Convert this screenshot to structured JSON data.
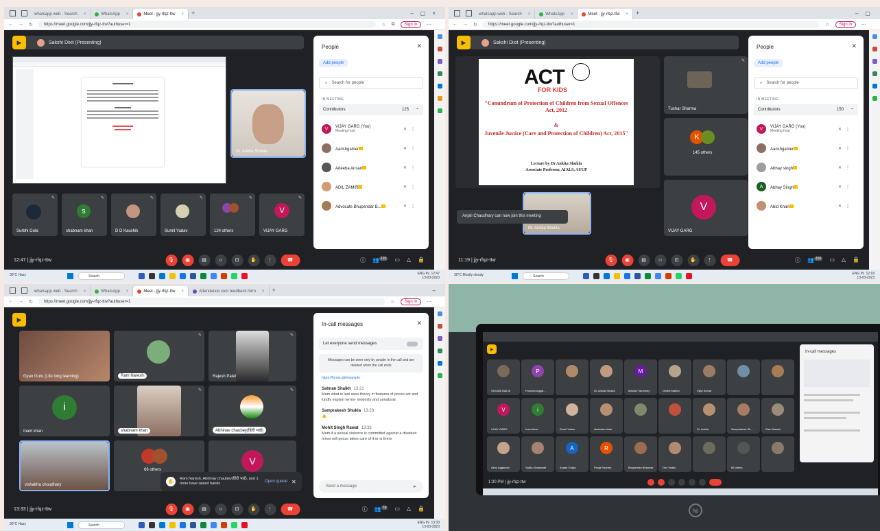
{
  "q1": {
    "tabs": [
      "whatsapp web - Search",
      "WhatsApp",
      "Meet - jjy-rfqz-ttw"
    ],
    "url": "https://meet.google.com/jjy-rfqz-ttw?authuser=1",
    "signin": "Sign in",
    "presenting": "Sakshi Dixit (Presenting)",
    "main_tile_name": "Dr. Ankita Shukla",
    "tiles": [
      "Surbhi Gola",
      "shabnam khan",
      "D D Kaushik",
      "Sumit Yadav",
      "124 others",
      "VIJAY GARG"
    ],
    "tile_initials": [
      "",
      "s",
      "",
      "",
      "",
      "V"
    ],
    "time": "12:47 | jjy-rfqz-ttw",
    "badge": "126",
    "panel": {
      "title": "People",
      "add": "Add people",
      "search": "Search for people",
      "in_meeting": "IN MEETING",
      "contributors": "Contributors",
      "count": "125",
      "people": [
        {
          "name": "VIJAY GARG (You)",
          "sub": "Meeting host",
          "init": "V"
        },
        {
          "name": "Aarishgamer",
          "sub": "",
          "init": ""
        },
        {
          "name": "Adeeba Ansari",
          "sub": "",
          "init": ""
        },
        {
          "name": "ADIL ZAMIR",
          "sub": "",
          "init": ""
        },
        {
          "name": "Advocate Bhupendar B...",
          "sub": "",
          "init": ""
        }
      ]
    },
    "taskbar": {
      "weather": "30°C Hazy",
      "search": "Search",
      "time": "12:47",
      "date": "13-03-2023",
      "lang": "ENG IN"
    }
  },
  "q2": {
    "tabs": [
      "whatsapp web - Search",
      "WhatsApp",
      "Meet - jjy-rfqz-ttw"
    ],
    "url": "https://meet.google.com/jjy-rfqz-ttw?authuser=1",
    "signin": "Sign in",
    "presenting": "Sakshi Dixit (Presenting)",
    "slide": {
      "logo1": "ACT",
      "logo2": "FOR KIDS",
      "line1": "\"Conundrum of Protection of Children from Sexual Offences Act, 2012",
      "line2": "&",
      "line3": "Juvenile Justice (Care and Protection of Children) Act, 2015\"",
      "lecture": "Lecture by Dr Ankita Shukla",
      "role": "Associate Professor, AIALS, AUUP"
    },
    "tiles": [
      "Tushar Sharma",
      "145 others",
      "VIJAY GARG"
    ],
    "tile_initials": [
      "",
      "K",
      "V"
    ],
    "self_name": "Dr. Ankita Shukla",
    "toast": "Anjali Chaudhary can now join this meeting",
    "time": "11:19 | jjy-rfqz-ttw",
    "badge": "150",
    "panel": {
      "title": "People",
      "add": "Add people",
      "search": "Search for people",
      "in_meeting": "IN MEETING",
      "contributors": "Contributors",
      "count": "150",
      "people": [
        {
          "name": "VIJAY GARG (You)",
          "sub": "Meeting host",
          "init": "V"
        },
        {
          "name": "Aarishgamer",
          "sub": "",
          "init": ""
        },
        {
          "name": "Abhay singh",
          "sub": "",
          "init": ""
        },
        {
          "name": "Abhay Singh",
          "sub": "",
          "init": "A"
        },
        {
          "name": "Abid Khan",
          "sub": "",
          "init": ""
        }
      ]
    },
    "taskbar": {
      "weather": "30°C Mostly cloudy",
      "search": "Search",
      "time": "12:18",
      "date": "13-03-2023",
      "lang": "ENG IN"
    }
  },
  "q3": {
    "tabs": [
      "whatsapp web - Search",
      "WhatsApp",
      "Meet - jjy-rfqz-ttw",
      "Attendance cum feedback form"
    ],
    "url": "https://meet.google.com/jjy-rfqz-ttw?authuser=1",
    "signin": "Sign in",
    "tiles": [
      "Gyan Guru (Life long learning)",
      "Ram Naresh",
      "Rajesh Patel",
      "Inam khan",
      "shabnam khan",
      "Abhinav chaubey(हिंदी भाई)",
      "vishakha choudhary",
      "66 others",
      ""
    ],
    "tile_initials": [
      "",
      "",
      "",
      "i",
      "",
      "",
      "",
      "",
      "V"
    ],
    "raise": "Ram Naresh, Abhinav chaubey(हिंदी भाई), and 1 more have raised hands",
    "open_queue": "Open queue",
    "time": "13:33 | jjy-rfqz-ttw",
    "badge": "74",
    "chat": {
      "title": "In-call messages",
      "toggle": "Let everyone send messages",
      "note": "Messages can be seen only by people in the call and are deleted when the call ends",
      "link": "https://forms.gle/example",
      "messages": [
        {
          "who": "Salman Shaikh",
          "ts": "13:21",
          "txt": "Mam what is last seen theory in features of pocso act and kindly explain terms- modesty and unnatural"
        },
        {
          "who": "Samprakesh Shukla",
          "ts": "13:23",
          "txt": "👍"
        },
        {
          "who": "Mohit Singh Rawat",
          "ts": "13:33",
          "txt": "Mam if a sexual violence is committed against a disabled minor will pocso takes care of it or is there"
        }
      ],
      "input": "Send a message"
    },
    "taskbar": {
      "weather": "30°C Hazy",
      "search": "Search",
      "time": "13:33",
      "date": "13-03-2023",
      "lang": "ENG IN"
    }
  },
  "q4": {
    "panel_title": "In-call messages",
    "time": "1:30 PM | jjy-rfqz-ttw",
    "tiles": [
      "SHOAIB MALIK",
      "Poonam Aggar...",
      "",
      "Dr. Ankita Shukla",
      "Madhur Varshney",
      "Drishti Mathur",
      "Vijay Kumar",
      "",
      "",
      "VIJAY GARG",
      "Inam khan",
      "Sumit Yadav",
      "shabnam khan",
      "",
      "",
      "Dr. Ankita",
      "Samprakesh Sh...",
      "Ram Naresh",
      "Ashu Aggarwal",
      "Sadhu Saraswati",
      "Azaan Gupta",
      "Pooja Sharma",
      "Bhupendra Bhanwar",
      "Dev Yadav",
      "",
      "66 others",
      ""
    ],
    "tile_initials": [
      "",
      "P",
      "",
      "",
      "M",
      "",
      "",
      "",
      "",
      "V",
      "i",
      "",
      "",
      "",
      "",
      "",
      "",
      "",
      "",
      "",
      "A",
      "R",
      "",
      "",
      "",
      "",
      ""
    ]
  }
}
